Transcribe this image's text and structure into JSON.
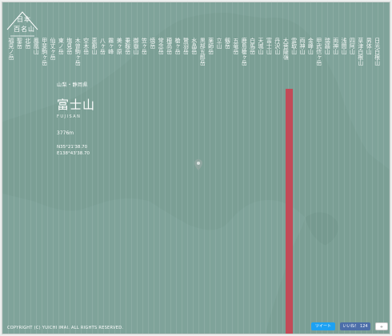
{
  "logo": {
    "line1": "日本",
    "line2": "百名山"
  },
  "mountains": [
    "福見ノ岳",
    "聖岳",
    "北岳",
    "鳳凰山",
    "甲斐駒ヶ岳",
    "仙丈ヶ岳",
    "東ノ岳",
    "塩見岳",
    "木曽駒ヶ岳",
    "空木岳",
    "恵那山",
    "八ヶ岳",
    "霧ヶ峰",
    "美ヶ原",
    "乗鞍岳",
    "御嶽山",
    "笠ヶ岳",
    "焼岳",
    "常念岳",
    "穂高岳",
    "槍ヶ岳",
    "鷲羽岳",
    "水晶岳",
    "黒部五郎岳",
    "薬師岳",
    "立山",
    "剱岳",
    "五竜岳",
    "鹿島槍ヶ岳",
    "白馬岳",
    "天城山",
    "富士山",
    "丹沢山",
    "大菩薩嶺",
    "雲取山",
    "両神山",
    "金峰山",
    "甲武信ヶ岳",
    "瑞牆山",
    "両神山",
    "浅間山",
    "四阿山",
    "草津白根山",
    "男体山",
    "日光白根山"
  ],
  "selected": {
    "prefecture": "山梨・静岡県",
    "name": "富士山",
    "roman": "FUJISAN",
    "elevation": "3776m",
    "lat": "N35°21'38.70",
    "lon": "E138°43'38.70"
  },
  "footer": {
    "copyright": "COPYRIGHT (C) YUICHI IMAI. ALL RIGHTS RESERVED.",
    "tweet_label": "ツイート",
    "like_label": "いいね！ 124",
    "gplus_label": "+"
  },
  "colors": {
    "background": "#7fa39a",
    "highlight": "#c24b58",
    "text": "#ffffff"
  }
}
